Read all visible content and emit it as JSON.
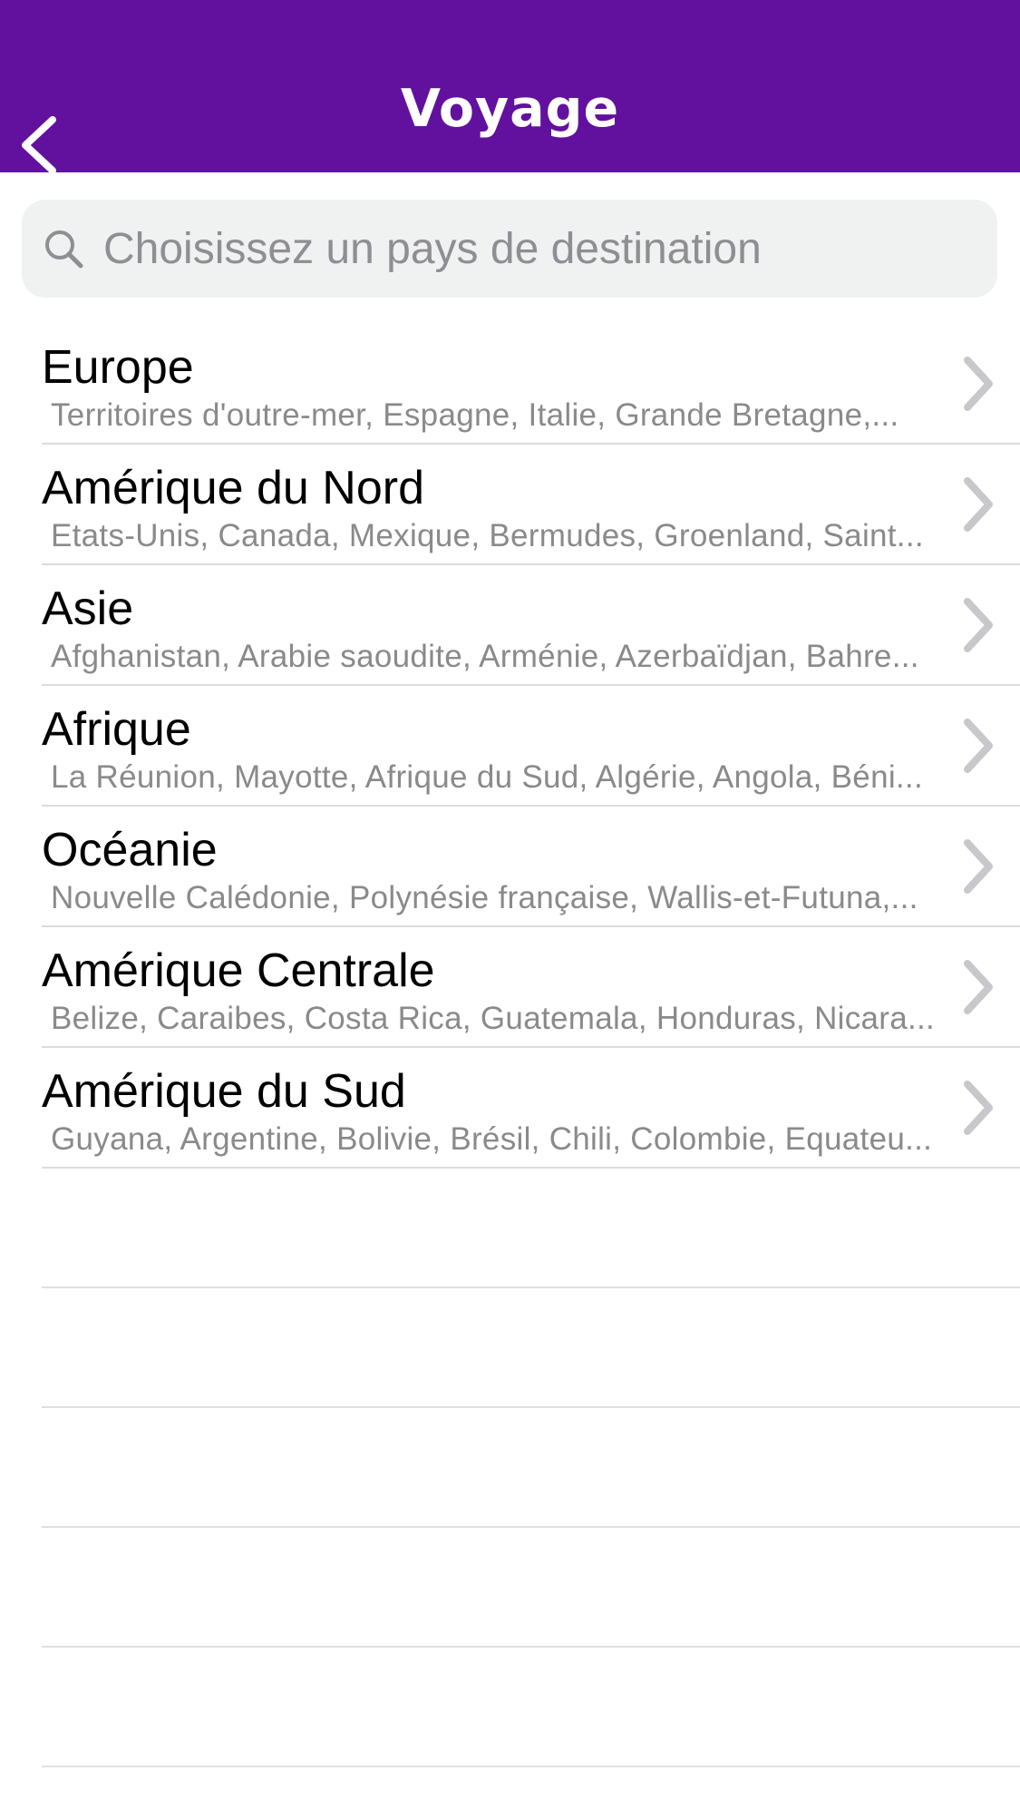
{
  "header": {
    "title": "Voyage",
    "background_color": "#62119e"
  },
  "search": {
    "placeholder": "Choisissez un pays de destination",
    "value": ""
  },
  "regions": [
    {
      "title": "Europe",
      "countries": "Territoires d'outre-mer, Espagne, Italie, Grande Bretagne,..."
    },
    {
      "title": "Amérique du Nord",
      "countries": "Etats-Unis, Canada, Mexique, Bermudes, Groenland, Saint..."
    },
    {
      "title": "Asie",
      "countries": "Afghanistan, Arabie saoudite, Arménie, Azerbaïdjan, Bahre..."
    },
    {
      "title": "Afrique",
      "countries": "La Réunion, Mayotte, Afrique du Sud, Algérie, Angola, Béni..."
    },
    {
      "title": "Océanie",
      "countries": "Nouvelle Calédonie, Polynésie française, Wallis-et-Futuna,..."
    },
    {
      "title": "Amérique Centrale",
      "countries": "Belize, Caraibes, Costa Rica, Guatemala, Honduras, Nicara..."
    },
    {
      "title": "Amérique du Sud",
      "countries": "Guyana, Argentine, Bolivie, Brésil, Chili, Colombie, Equateu..."
    }
  ],
  "icons": {
    "back": "chevron-left-icon",
    "search": "search-icon",
    "row_disclosure": "chevron-right-icon"
  }
}
